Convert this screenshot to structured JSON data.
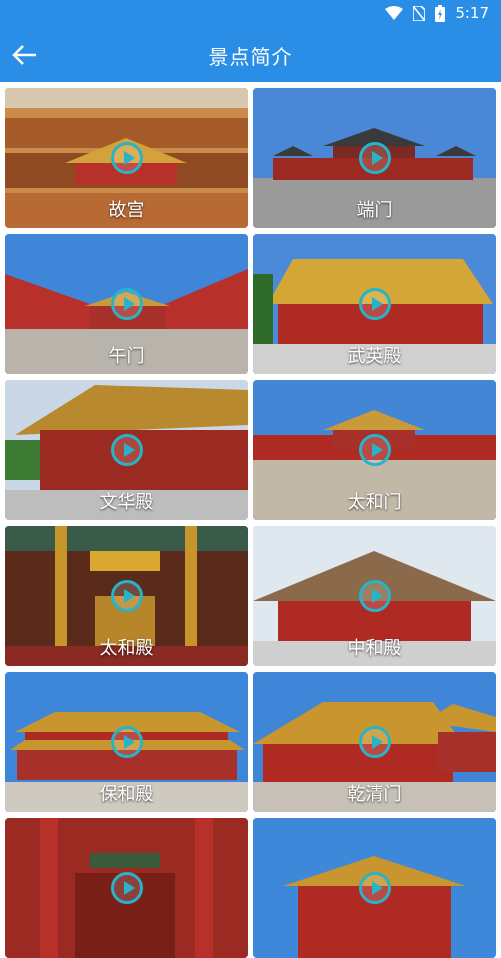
{
  "status_bar": {
    "time": "5:17",
    "icons": [
      "wifi-icon",
      "no-sim-icon",
      "battery-icon"
    ]
  },
  "app_bar": {
    "title": "景点简介",
    "back_icon": "arrow-left-icon"
  },
  "colors": {
    "header": "#2b8ee6",
    "play_accent": "#27b4c8",
    "label": "#ffffff"
  },
  "attractions": [
    {
      "label": "故宫"
    },
    {
      "label": "端门"
    },
    {
      "label": "午门"
    },
    {
      "label": "武英殿"
    },
    {
      "label": "文华殿"
    },
    {
      "label": "太和门"
    },
    {
      "label": "太和殿"
    },
    {
      "label": "中和殿"
    },
    {
      "label": "保和殿"
    },
    {
      "label": "乾清门"
    },
    {
      "label": ""
    },
    {
      "label": ""
    }
  ]
}
